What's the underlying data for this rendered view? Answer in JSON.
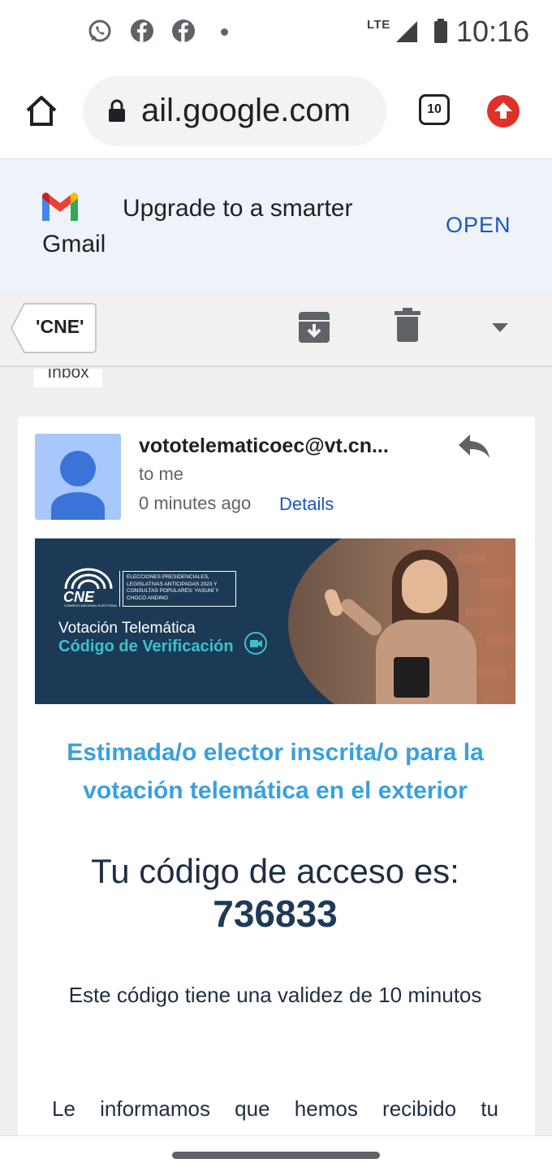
{
  "status_bar": {
    "network": "LTE",
    "time": "10:16",
    "notification_icons": [
      "whatsapp-icon",
      "facebook-icon",
      "facebook-icon"
    ]
  },
  "browser": {
    "url": "ail.google.com",
    "tab_count": "10"
  },
  "promo": {
    "brand": "Gmail",
    "text": "Upgrade to a smarter",
    "action": "OPEN"
  },
  "thread": {
    "back_label": "'CNE'",
    "label_chip": "Inbox"
  },
  "message": {
    "sender": "vototelematicoec@vt.cn...",
    "recipient": "to me",
    "timestamp": "0 minutes ago",
    "details_link": "Details"
  },
  "banner": {
    "logo_text": "CNE",
    "logo_subtext": "CONSEJO NACIONAL ELECTORAL",
    "election_text": "ELECCIONES PRESIDENCIALES, LEGISLATIVAS ANTICIPADAS 2023 Y CONSULTAS POPULARES: YASUNÍ Y CHOCÓ ANDINO",
    "title_line1": "Votación Telemática",
    "title_line2": "Código de Verificación"
  },
  "body": {
    "greeting": "Estimada/o elector inscrita/o para la votación telemática en el exterior",
    "code_intro": "Tu código de acceso es:",
    "code": "736833",
    "validity": "Este código tiene una validez de 10 minutos",
    "info": "Le informamos que hemos recibido tu"
  },
  "colors": {
    "accent_blue": "#1a56c4",
    "greeting_blue": "#3aa0de",
    "banner_navy": "#1c3a55",
    "banner_teal": "#39c2cd",
    "upgrade_red": "#e0302a"
  }
}
